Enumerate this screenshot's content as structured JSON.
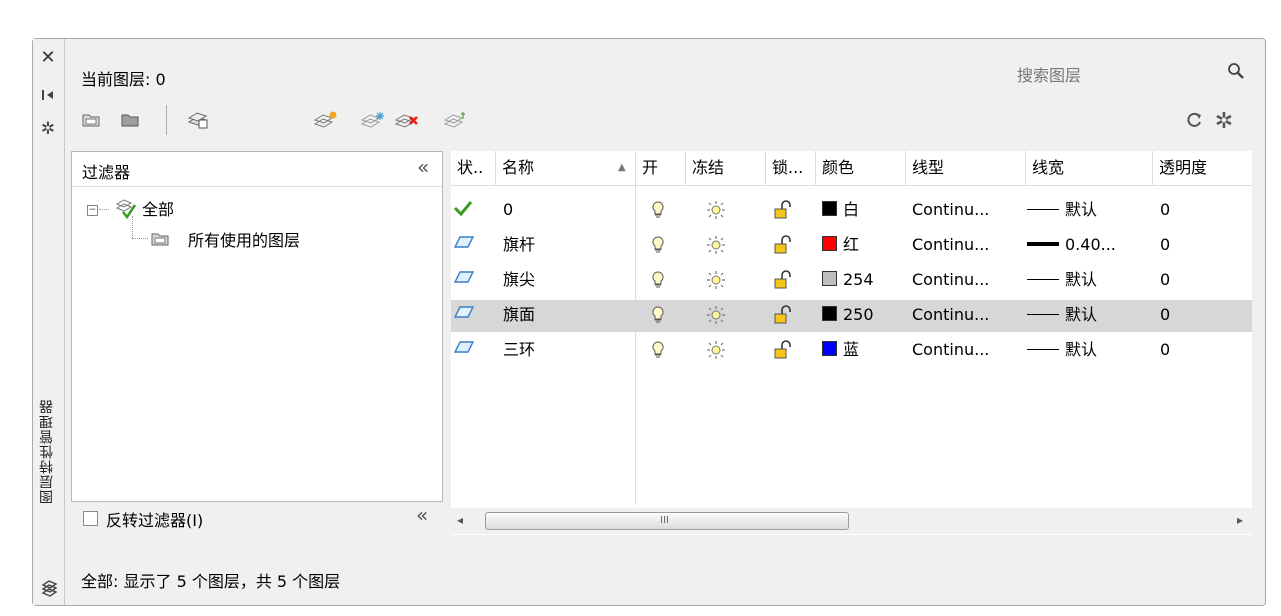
{
  "side": {
    "title": "图层特性管理器",
    "close_icon": "close-icon",
    "pin_icon": "autohide-icon",
    "settings_icon": "properties-icon"
  },
  "header": {
    "current_layer": "当前图层: 0",
    "search_placeholder": "搜索图层"
  },
  "filters": {
    "title": "过滤器",
    "collapse": "«",
    "tree": [
      {
        "label": "全部",
        "icon": "filter-all-icon"
      },
      {
        "label": "所有使用的图层",
        "icon": "filter-used-icon"
      }
    ],
    "invert_label": "反转过滤器(I)",
    "invert_collapse": "«"
  },
  "columns": [
    "状..",
    "名称",
    "开",
    "冻结",
    "锁...",
    "颜色",
    "线型",
    "线宽",
    "透明度"
  ],
  "layers": [
    {
      "status": "current",
      "name": "0",
      "color_hex": "#000000",
      "color_label": "白",
      "linetype": "Continu...",
      "lineweight": "默认",
      "lw_bold": false,
      "transparency": "0",
      "selected": false
    },
    {
      "status": "layer",
      "name": "旗杆",
      "color_hex": "#ff0000",
      "color_label": "红",
      "linetype": "Continu...",
      "lineweight": "0.40...",
      "lw_bold": true,
      "transparency": "0",
      "selected": false
    },
    {
      "status": "layer",
      "name": "旗尖",
      "color_hex": "#bebebe",
      "color_label": "254",
      "linetype": "Continu...",
      "lineweight": "默认",
      "lw_bold": false,
      "transparency": "0",
      "selected": false
    },
    {
      "status": "layer",
      "name": "旗面",
      "color_hex": "#000000",
      "color_label": "250",
      "linetype": "Continu...",
      "lineweight": "默认",
      "lw_bold": false,
      "transparency": "0",
      "selected": true
    },
    {
      "status": "layer",
      "name": "三环",
      "color_hex": "#0000ff",
      "color_label": "蓝",
      "linetype": "Continu...",
      "lineweight": "默认",
      "lw_bold": false,
      "transparency": "0",
      "selected": false
    }
  ],
  "scrollbar": {
    "thumb_label": "III"
  },
  "status_bar": {
    "text": "全部: 显示了 5 个图层，共 5 个图层"
  }
}
